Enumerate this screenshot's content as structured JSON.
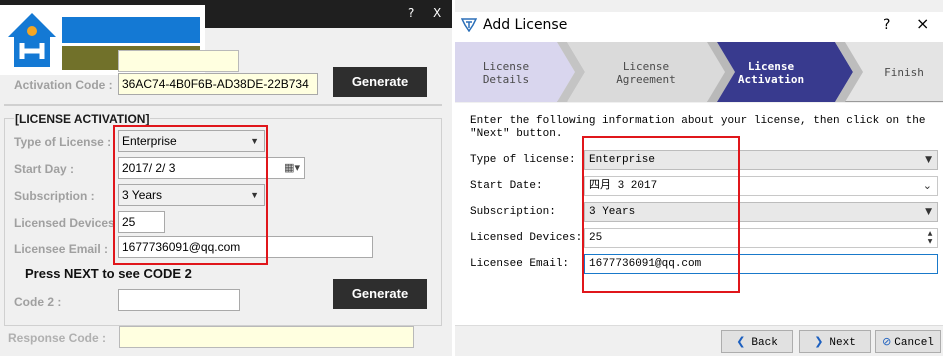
{
  "keygen": {
    "titlebar": {
      "help": "?",
      "close": "X"
    },
    "activation_code_label": "Activation Code :",
    "activation_code_value": "36AC74-4B0F6B-AD38DE-22B734",
    "generate_label": "Generate",
    "section_heading": "[LICENSE ACTIVATION]",
    "type_label": "Type of License :",
    "type_value": "Enterprise",
    "start_day_label": "Start Day :",
    "start_day_value": "2017/  2/  3",
    "subscription_label": "Subscription :",
    "subscription_value": "3 Years",
    "devices_label": "Licensed Devices :",
    "devices_value": "25",
    "email_label": "Licensee Email :",
    "email_value": "1677736091@qq.com",
    "hint": "Press NEXT to see CODE 2",
    "code2_label": "Code 2 :",
    "generate2_label": "Generate",
    "response_label": "Response Code :",
    "colors": {
      "titlebar": "#1f1f1f",
      "button": "#2e2e2e",
      "highlight": "#e0161b"
    }
  },
  "dialog": {
    "title": "Add License",
    "help": "?",
    "close": "×",
    "steps": [
      {
        "line1": "License",
        "line2": "Details"
      },
      {
        "line1": "License",
        "line2": "Agreement"
      },
      {
        "line1": "License",
        "line2": "Activation"
      },
      {
        "line1": "Finish",
        "line2": ""
      }
    ],
    "active_step_color": "#383a8e",
    "intro": "Enter the following information about your license, then click on the \"Next\" button.",
    "fields": {
      "type": {
        "label": "Type of license:",
        "value": "Enterprise"
      },
      "start": {
        "label": "Start Date:",
        "value": "四月  3 2017"
      },
      "subscription": {
        "label": "Subscription:",
        "value": "3 Years"
      },
      "devices": {
        "label": "Licensed Devices:",
        "value": "25"
      },
      "email": {
        "label": "Licensee Email:",
        "value": "1677736091@qq.com"
      }
    },
    "buttons": {
      "back": "Back",
      "next": "Next",
      "cancel": "Cancel"
    }
  }
}
